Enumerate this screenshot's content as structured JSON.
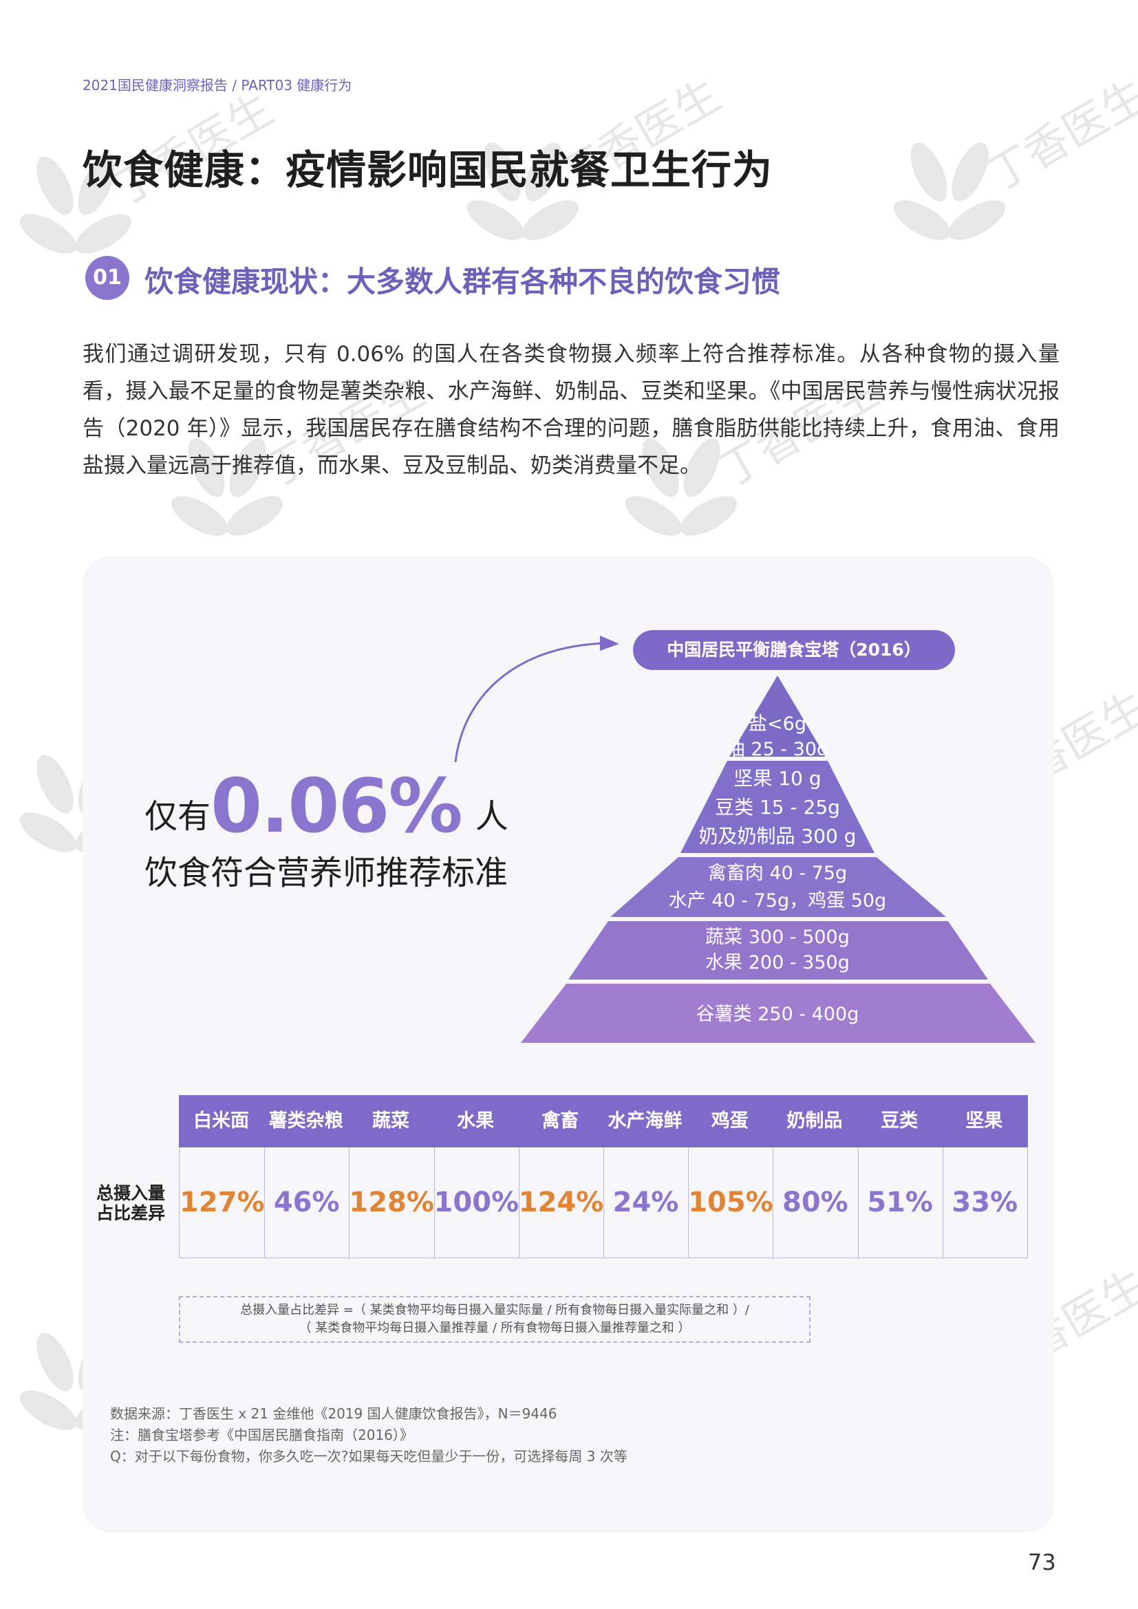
{
  "header": {
    "breadcrumb": "2021国民健康洞察报告 / PART03 健康行为",
    "title": "饮食健康：疫情影响国民就餐卫生行为"
  },
  "section": {
    "number": "01",
    "title": "饮食健康现状：大多数人群有各种不良的饮食习惯"
  },
  "intro": "我们通过调研发现，只有 0.06% 的国人在各类食物摄入频率上符合推荐标准。从各种食物的摄入量看，摄入最不足量的食物是薯类杂粮、水产海鲜、奶制品、豆类和坚果。《中国居民营养与慢性病状况报告（2020 年）》显示，我国居民存在膳食结构不合理的问题，膳食脂肪供能比持续上升，食用油、食用盐摄入量远高于推荐值，而水果、豆及豆制品、奶类消费量不足。",
  "highlight": {
    "prefix": "仅有",
    "percent": "0.06%",
    "suffix": "人",
    "line2": "饮食符合营养师推荐标准"
  },
  "pyramid": {
    "title": "中国居民平衡膳食宝塔（2016）",
    "levels": [
      {
        "lines": [
          "盐<6g",
          "油 25 - 30g"
        ],
        "color": "#7b6bc7"
      },
      {
        "lines": [
          "坚果 10 g",
          "豆类 15 - 25g",
          "奶及奶制品 300 g"
        ],
        "color": "#8070c9"
      },
      {
        "lines": [
          "禽畜肉 40 - 75g",
          "水产 40 - 75g，鸡蛋 50g"
        ],
        "color": "#8a73cb"
      },
      {
        "lines": [
          "蔬菜 300 - 500g",
          "水果 200 - 350g"
        ],
        "color": "#9476cc"
      },
      {
        "lines": [
          "谷薯类 250 - 400g"
        ],
        "color": "#a17ccf"
      }
    ]
  },
  "table": {
    "row_label_1": "总摄入量",
    "row_label_2": "占比差异",
    "columns": [
      {
        "name": "白米面",
        "value": "127%",
        "color": "#e08436"
      },
      {
        "name": "薯类杂粮",
        "value": "46%",
        "color": "#8a76cf"
      },
      {
        "name": "蔬菜",
        "value": "128%",
        "color": "#e08436"
      },
      {
        "name": "水果",
        "value": "100%",
        "color": "#8a76cf"
      },
      {
        "name": "禽畜",
        "value": "124%",
        "color": "#e08436"
      },
      {
        "name": "水产海鲜",
        "value": "24%",
        "color": "#8a76cf"
      },
      {
        "name": "鸡蛋",
        "value": "105%",
        "color": "#e08436"
      },
      {
        "name": "奶制品",
        "value": "80%",
        "color": "#8a76cf"
      },
      {
        "name": "豆类",
        "value": "51%",
        "color": "#8a76cf"
      },
      {
        "name": "坚果",
        "value": "33%",
        "color": "#8a76cf"
      }
    ]
  },
  "formula": {
    "line1": "总摄入量占比差异 =（ 某类食物平均每日摄入量实际量 / 所有食物每日摄入量实际量之和 ）/",
    "line2": "（ 某类食物平均每日摄入量推荐量 / 所有食物每日摄入量推荐量之和 ）"
  },
  "notes": [
    "数据来源：丁香医生 x 21 金维他《2019 国人健康饮食报告》，N＝9446",
    "注：膳食宝塔参考《中国居民膳食指南（2016）》",
    "Q：对于以下每份食物，你多久吃一次?如果每天吃但量少于一份，可选择每周 3 次等"
  ],
  "watermark": "丁香医生",
  "page_number": "73",
  "colors": {
    "accent": "#8a76cf",
    "header": "#7e6bc9",
    "over": "#e08436"
  }
}
